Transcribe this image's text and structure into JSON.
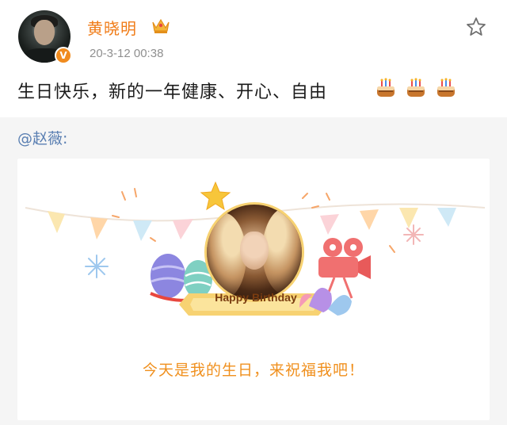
{
  "post": {
    "author": "黄晓明",
    "verified_badge": "V",
    "timestamp": "20-3-12 00:38",
    "text": "生日快乐，新的一年健康、开心、自由",
    "cake_emoji_count": 3
  },
  "repost": {
    "mention": "@赵薇:",
    "card": {
      "ribbon_text": "Happy Birthday",
      "caption": "今天是我的生日，来祝福我吧！"
    }
  },
  "icons": {
    "crown": "crown-icon",
    "favorite": "star-outline-icon",
    "cake": "birthday-cake-icon"
  },
  "colors": {
    "username": "#f07c18",
    "mention": "#5a7fb2",
    "caption": "#f0901e",
    "timestamp": "#8f8f8f"
  }
}
